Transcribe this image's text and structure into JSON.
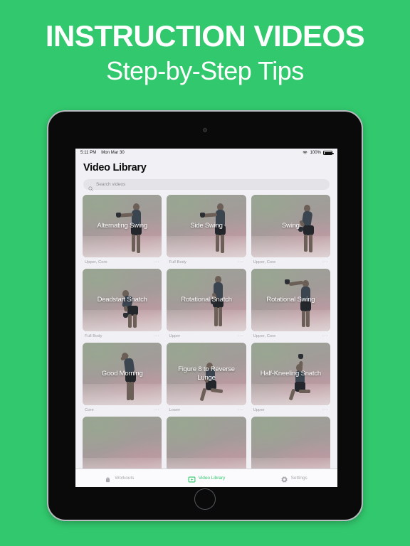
{
  "promo": {
    "title": "INSTRUCTION VIDEOS",
    "subtitle": "Step-by-Step Tips",
    "background_color": "#32c96e",
    "text_color": "#ffffff"
  },
  "device": {
    "type": "tablet",
    "frame_color": "#0a0a0a",
    "edge_color": "#b9bcc0"
  },
  "status_bar": {
    "time": "5:11 PM",
    "date": "Mon Mar 30",
    "wifi_icon": "wifi-icon",
    "battery_percent": "100%",
    "battery_icon": "battery-full-icon"
  },
  "header": {
    "title": "Video Library"
  },
  "search": {
    "placeholder": "Search videos",
    "icon": "search-icon",
    "value": ""
  },
  "accent_color": "#32c96e",
  "library": {
    "more_dots": "···",
    "videos": [
      {
        "title": "Alternating Swing",
        "tags": "Upper, Core",
        "pose": "swing-right"
      },
      {
        "title": "Side Swing",
        "tags": "Full Body",
        "pose": "swing-right"
      },
      {
        "title": "Swing",
        "tags": "Upper, Core",
        "pose": "hinge"
      },
      {
        "title": "Deadstart Snatch",
        "tags": "Full Body",
        "pose": "squat"
      },
      {
        "title": "Rotational Snatch",
        "tags": "Upper",
        "pose": "stand"
      },
      {
        "title": "Rotational Swing",
        "tags": "Upper, Core",
        "pose": "overhead-front"
      },
      {
        "title": "Good Morning",
        "tags": "Core",
        "pose": "hinge-back"
      },
      {
        "title": "Figure 8 to Reverse Lunge",
        "tags": "Lower",
        "pose": "lunge"
      },
      {
        "title": "Half-Kneeling Snatch",
        "tags": "Upper",
        "pose": "kneel-overhead"
      }
    ]
  },
  "tabs": [
    {
      "label": "Workouts",
      "icon": "kettlebell-icon",
      "active": false
    },
    {
      "label": "Video Library",
      "icon": "video-play-icon",
      "active": true
    },
    {
      "label": "Settings",
      "icon": "gear-icon",
      "active": false
    }
  ]
}
